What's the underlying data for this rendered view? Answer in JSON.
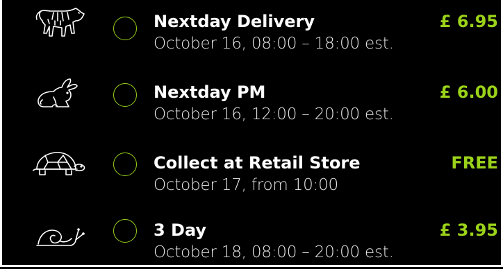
{
  "accent_color": "#9ad21a",
  "options": [
    {
      "icon": "tiger-icon",
      "title": "Nextday Delivery",
      "subtitle": "October 16, 08:00 – 18:00 est.",
      "price": "£ 6.95"
    },
    {
      "icon": "rabbit-icon",
      "title": "Nextday PM",
      "subtitle": "October 16, 12:00 – 20:00 est.",
      "price": "£ 6.00"
    },
    {
      "icon": "turtle-icon",
      "title": "Collect at Retail Store",
      "subtitle": "October 17, from 10:00",
      "price": "FREE"
    },
    {
      "icon": "snail-icon",
      "title": "3 Day",
      "subtitle": "October 18, 08:00 – 20:00 est.",
      "price": "£ 3.95"
    }
  ]
}
